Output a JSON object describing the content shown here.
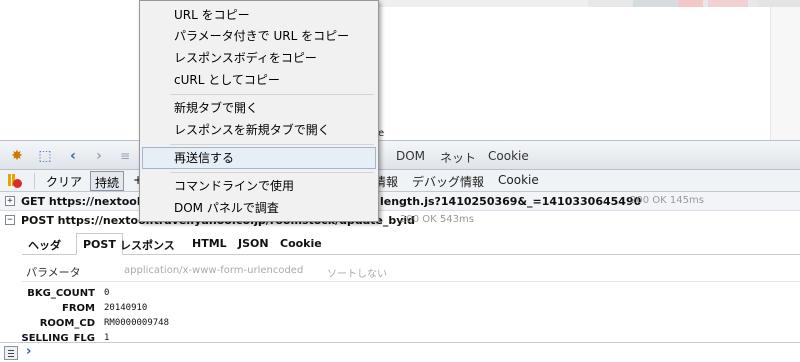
{
  "context_menu": {
    "items": [
      {
        "label": "URL をコピー"
      },
      {
        "label": "パラメータ付きで URL をコピー"
      },
      {
        "label": "レスポンスボディをコピー"
      },
      {
        "label": "cURL としてコピー"
      },
      {
        "label": "新規タブで開く"
      },
      {
        "label": "レスポンスを新規タブで開く"
      },
      {
        "label": "再送信する"
      },
      {
        "label": "コマンドラインで使用"
      },
      {
        "label": "DOM パネルで調査"
      }
    ]
  },
  "toolbar1": {
    "tabs": {
      "dom": "DOM",
      "net": "ネット",
      "cookie": "Cookie"
    }
  },
  "toolbar2": {
    "clear": "クリア",
    "persist": "持続",
    "partial": "+",
    "info_tab": "情報",
    "debug_tab": "デバッグ情報",
    "cookie_tab": "Cookie"
  },
  "requests": {
    "get": {
      "line": "GET https://nextool.",
      "tail": "length.js?1410250369&_=1410330645490",
      "status": "200 OK 145ms"
    },
    "post": {
      "line": "POST https://nextool.travel.yahoo.co.jp/roomstock/update_byid",
      "status": "200 OK 543ms"
    }
  },
  "detail_tabs": [
    "ヘッダ",
    "POST",
    "レスポンス",
    "HTML",
    "JSON",
    "Cookie"
  ],
  "params": {
    "header_label": "パラメータ",
    "content_type": "application/x-www-form-urlencoded",
    "sort": "ソートしない",
    "rows": [
      {
        "key": "BKG_COUNT",
        "value": "0"
      },
      {
        "key": "FROM",
        "value": "20140910"
      },
      {
        "key": "ROOM_CD",
        "value": "RM0000009748"
      },
      {
        "key": "SELLING_FLG",
        "value": "1"
      }
    ]
  },
  "cmdline": {
    "prompt": "›"
  }
}
